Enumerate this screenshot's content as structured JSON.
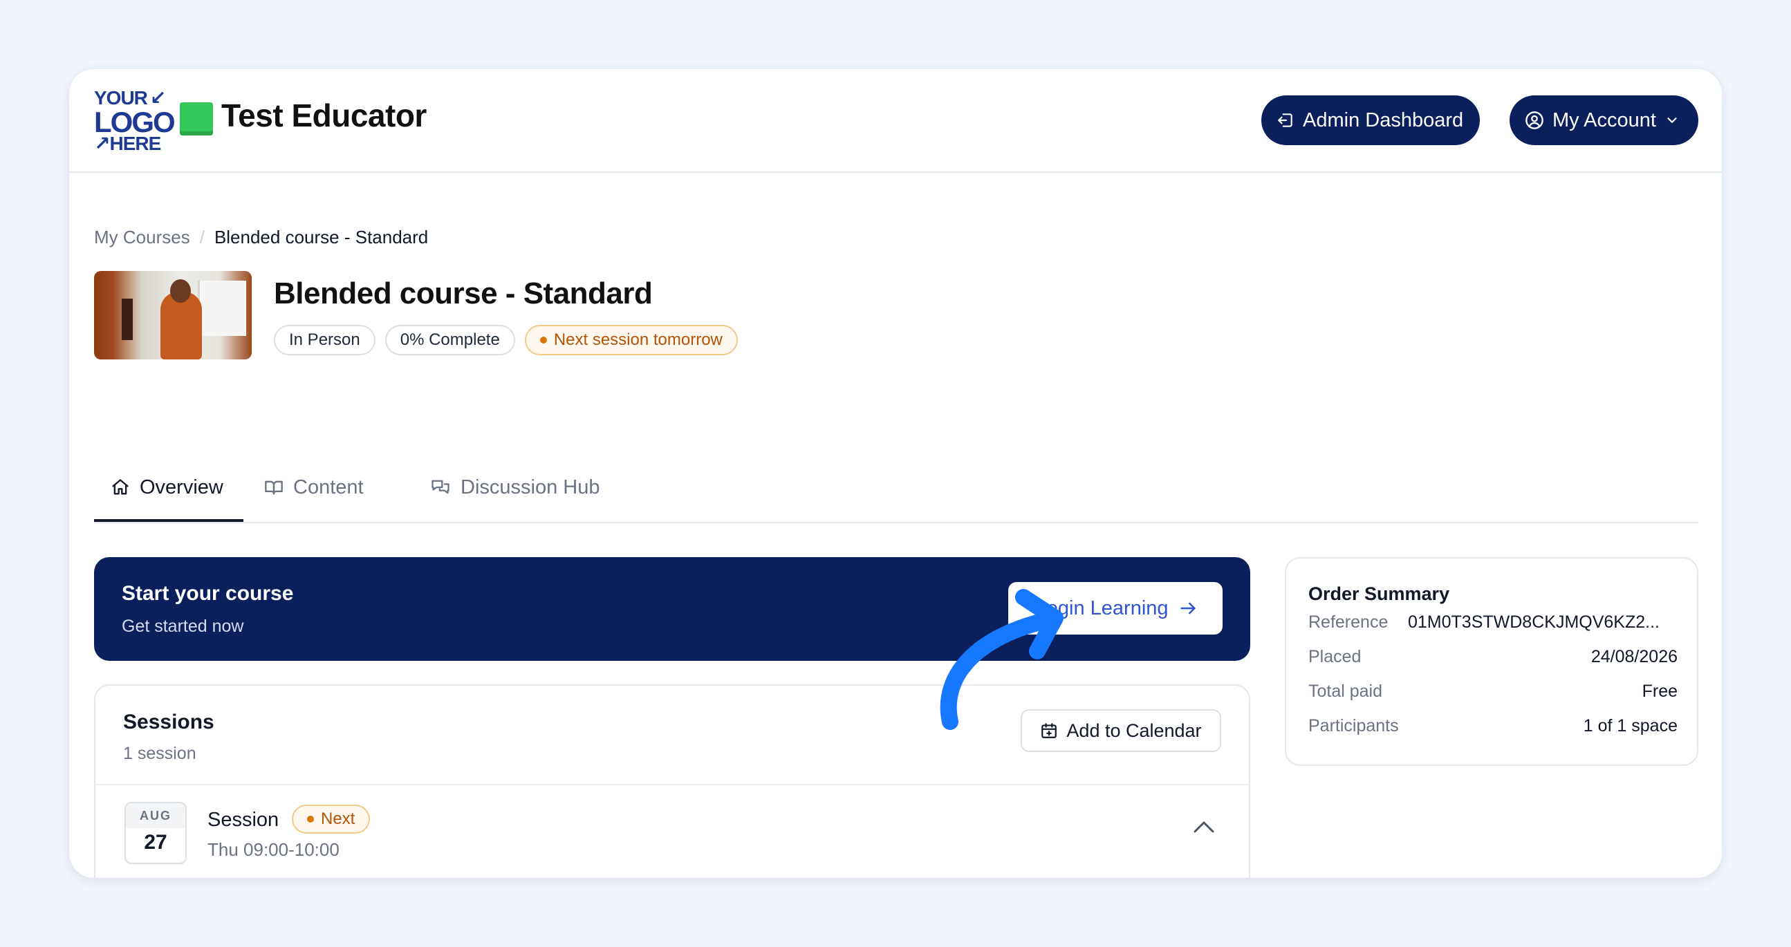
{
  "header": {
    "logo": {
      "line1": "YOUR",
      "line2": "LOGO",
      "line3": "HERE"
    },
    "brand_name": "Test Educator",
    "admin_button": "Admin Dashboard",
    "account_button": "My Account"
  },
  "breadcrumb": {
    "parent": "My Courses",
    "separator": "/",
    "current": "Blended course - Standard"
  },
  "course": {
    "title": "Blended course - Standard",
    "chips": {
      "mode": "In Person",
      "progress": "0% Complete",
      "next_session": "Next session tomorrow"
    }
  },
  "tabs": [
    {
      "label": "Overview",
      "icon": "home-icon",
      "active": true
    },
    {
      "label": "Content",
      "icon": "book-icon",
      "active": false
    },
    {
      "label": "Discussion Hub",
      "icon": "chat-icon",
      "active": false
    }
  ],
  "start_banner": {
    "title": "Start your course",
    "subtitle": "Get started now",
    "button": "Begin Learning"
  },
  "sessions": {
    "title": "Sessions",
    "count": "1 session",
    "calendar_button": "Add to Calendar",
    "items": [
      {
        "month": "AUG",
        "day": "27",
        "name": "Session",
        "badge": "Next",
        "time": "Thu 09:00-10:00"
      }
    ]
  },
  "order_summary": {
    "title": "Order Summary",
    "rows": [
      {
        "label": "Reference",
        "value": "01M0T3STWD8CKJMQV6KZ2..."
      },
      {
        "label": "Placed",
        "value": "24/08/2026"
      },
      {
        "label": "Total paid",
        "value": "Free"
      },
      {
        "label": "Participants",
        "value": "1 of 1 space"
      }
    ]
  },
  "colors": {
    "navy": "#0a1f5c",
    "accent_blue": "#2f55d4",
    "annotation_arrow": "#1677ff",
    "warning": "#b45309",
    "background": "#f1f5fc"
  }
}
